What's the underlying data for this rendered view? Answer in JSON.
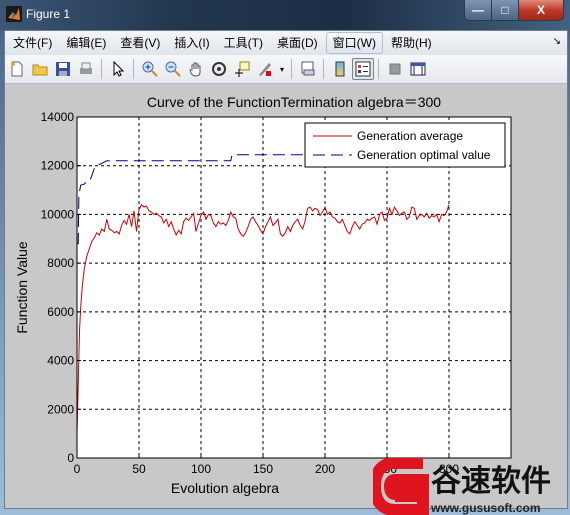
{
  "window": {
    "title": "Figure 1",
    "controls": {
      "minimize": "—",
      "maximize": "□",
      "close": "X"
    }
  },
  "menubar": {
    "items": [
      {
        "label": "文件(F)"
      },
      {
        "label": "编辑(E)"
      },
      {
        "label": "查看(V)"
      },
      {
        "label": "插入(I)"
      },
      {
        "label": "工具(T)"
      },
      {
        "label": "桌面(D)"
      },
      {
        "label": "窗口(W)",
        "active": true
      },
      {
        "label": "帮助(H)"
      }
    ],
    "dock_arrow": "↘"
  },
  "toolbar": {
    "buttons": [
      {
        "icon": "new-figure-icon",
        "glyph": "🗋"
      },
      {
        "icon": "open-file-icon",
        "glyph": "📂"
      },
      {
        "icon": "save-icon",
        "glyph": "💾"
      },
      {
        "icon": "print-icon",
        "glyph": "🖶"
      },
      {
        "icon": "pointer-icon",
        "glyph": "➤"
      },
      {
        "icon": "zoom-in-icon",
        "glyph": "⊕"
      },
      {
        "icon": "zoom-out-icon",
        "glyph": "⊖"
      },
      {
        "icon": "pan-icon",
        "glyph": "✋"
      },
      {
        "icon": "rotate-3d-icon",
        "glyph": "⟲"
      },
      {
        "icon": "data-cursor-icon",
        "glyph": "⌖"
      },
      {
        "icon": "brush-icon",
        "glyph": "🖌"
      },
      {
        "icon": "link-plot-icon",
        "glyph": "⛓"
      },
      {
        "icon": "colorbar-icon",
        "glyph": "▯"
      },
      {
        "icon": "legend-icon",
        "glyph": "☰"
      },
      {
        "icon": "hide-plot-tools-icon",
        "glyph": "■"
      },
      {
        "icon": "show-plot-tools-icon",
        "glyph": "◫"
      }
    ]
  },
  "watermark": {
    "brand": "谷速软件",
    "url": "www.gususoft.com"
  },
  "chart_data": {
    "type": "line",
    "title": "Curve of the FunctionTermination algebra＝300",
    "xlabel": "Evolution algebra",
    "ylabel": "Function Value",
    "xlim": [
      0,
      350
    ],
    "ylim": [
      0,
      14000
    ],
    "xticks": [
      0,
      50,
      100,
      150,
      200,
      250,
      300
    ],
    "xtick_labels": [
      "0",
      "50",
      "100",
      "150",
      "200",
      "250",
      "300"
    ],
    "yticks": [
      0,
      2000,
      4000,
      6000,
      8000,
      10000,
      12000,
      14000
    ],
    "ytick_labels": [
      "0",
      "2000",
      "4000",
      "6000",
      "8000",
      "10000",
      "12000",
      "14000"
    ],
    "grid": true,
    "legend": {
      "placement": "top-right",
      "entries": [
        "Generation average",
        "Generation optimal value"
      ]
    },
    "series": [
      {
        "name": "Generation average",
        "color": "#cc0000",
        "style": "solid",
        "x": [
          0,
          1,
          2,
          3,
          4,
          5,
          6,
          7,
          8,
          10,
          12,
          14,
          16,
          18,
          20,
          22,
          24,
          26,
          28,
          30,
          32,
          34,
          36,
          38,
          40,
          42,
          44,
          46,
          48,
          50,
          52,
          54,
          56,
          58,
          60,
          62,
          64,
          66,
          68,
          70,
          72,
          74,
          76,
          78,
          80,
          82,
          84,
          86,
          88,
          90,
          92,
          94,
          96,
          98,
          100,
          102,
          104,
          106,
          108,
          110,
          112,
          114,
          116,
          118,
          120,
          122,
          124,
          126,
          128,
          130,
          132,
          134,
          136,
          138,
          140,
          142,
          144,
          146,
          148,
          150,
          152,
          154,
          156,
          158,
          160,
          162,
          164,
          166,
          168,
          170,
          172,
          174,
          176,
          178,
          180,
          182,
          184,
          186,
          188,
          190,
          192,
          194,
          196,
          198,
          200,
          202,
          204,
          206,
          208,
          210,
          212,
          214,
          216,
          218,
          220,
          222,
          224,
          226,
          228,
          230,
          232,
          234,
          236,
          238,
          240,
          242,
          244,
          246,
          248,
          250,
          252,
          254,
          256,
          258,
          260,
          262,
          264,
          266,
          268,
          270,
          272,
          274,
          276,
          278,
          280,
          282,
          284,
          286,
          288,
          290,
          292,
          294,
          296,
          298,
          300
        ],
        "y": [
          1000,
          3000,
          5200,
          6200,
          6900,
          7400,
          7800,
          8050,
          8300,
          8600,
          8900,
          9050,
          9250,
          9150,
          9400,
          9300,
          9800,
          9400,
          9350,
          9250,
          9300,
          9200,
          9550,
          9750,
          9600,
          10000,
          9500,
          10150,
          9300,
          10200,
          10400,
          10300,
          10350,
          10150,
          10100,
          10000,
          10050,
          9950,
          9900,
          9650,
          9800,
          9500,
          9700,
          9400,
          9150,
          9350,
          9200,
          9700,
          9850,
          9750,
          9900,
          10050,
          9300,
          9650,
          9950,
          10100,
          9800,
          10000,
          9950,
          9650,
          9500,
          9700,
          9600,
          9650,
          9550,
          9750,
          10100,
          9900,
          9850,
          9400,
          9200,
          9100,
          9250,
          9500,
          9800,
          9900,
          9700,
          9550,
          9350,
          9200,
          9500,
          9700,
          9900,
          9550,
          9650,
          9800,
          9200,
          9100,
          9250,
          9500,
          9300,
          9550,
          9700,
          9800,
          9550,
          9400,
          9750,
          10250,
          10300,
          10150,
          10250,
          10200,
          9950,
          10100,
          10300,
          10000,
          10100,
          9900,
          9850,
          9700,
          9650,
          9800,
          9550,
          9300,
          9200,
          9500,
          9700,
          9550,
          9400,
          9600,
          9650,
          9800,
          9750,
          9850,
          9900,
          9600,
          10000,
          10100,
          9750,
          9850,
          10250,
          10000,
          10300,
          10150,
          9950,
          10050,
          10100,
          9800,
          9900,
          10300,
          10250,
          9800,
          9950,
          10000,
          9900,
          10050,
          9850,
          9950,
          9900,
          10000,
          9700,
          10000,
          9950,
          10100,
          10400
        ]
      },
      {
        "name": "Generation optimal value",
        "color": "#000080",
        "style": "dashed",
        "x": [
          0,
          1,
          1.5,
          3,
          6,
          8,
          10,
          12,
          14,
          15,
          18,
          20,
          24,
          30,
          60,
          90,
          124,
          125,
          160,
          200,
          250
        ],
        "y": [
          8800,
          8800,
          10800,
          11200,
          11250,
          11350,
          11350,
          11600,
          11900,
          12000,
          12050,
          12100,
          12200,
          12200,
          12200,
          12200,
          12200,
          12450,
          12450,
          12450,
          12450
        ]
      }
    ]
  }
}
